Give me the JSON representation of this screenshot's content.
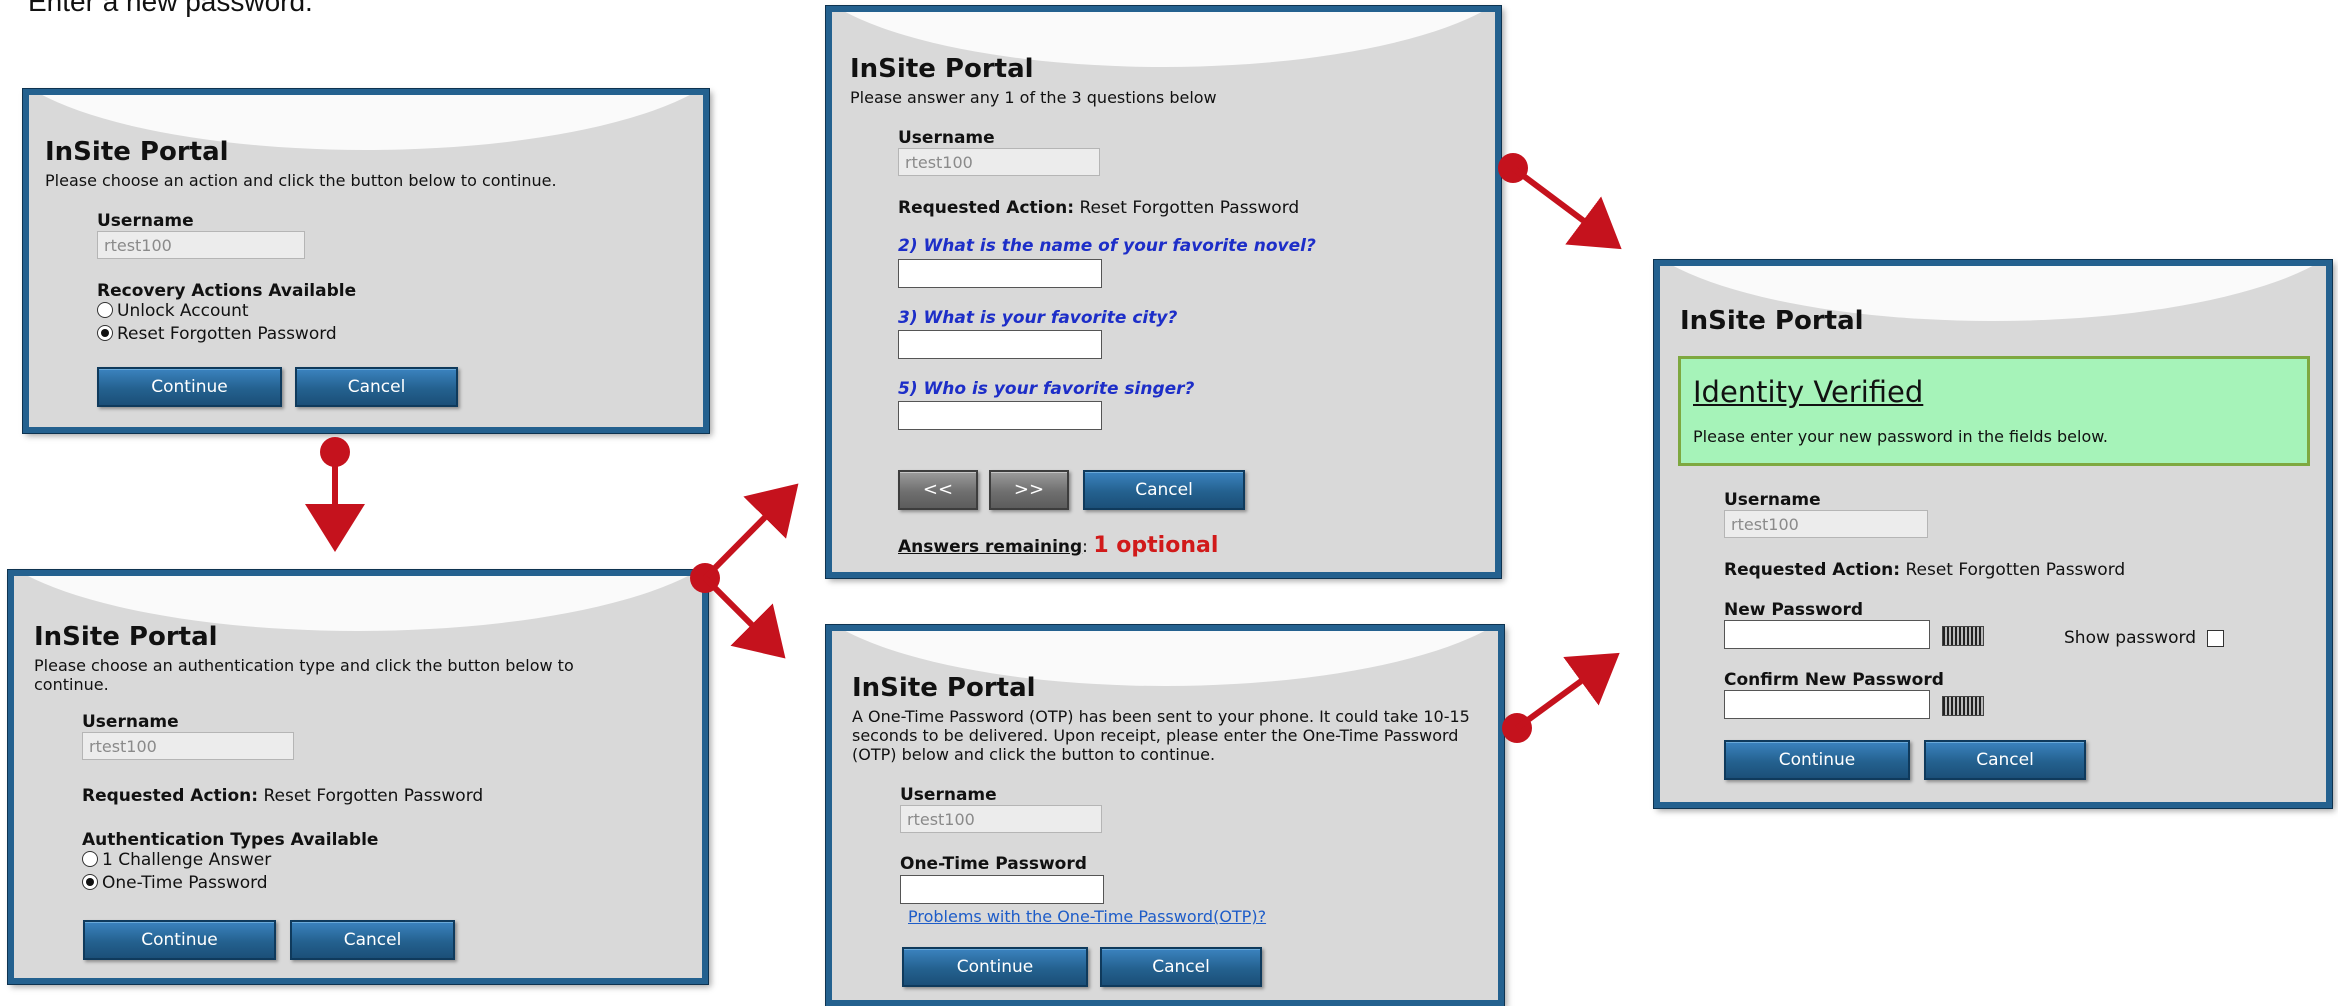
{
  "intro_text": "Enter a new password.",
  "portal_title": "InSite Portal",
  "panel1": {
    "description": "Please choose an action and click the button below to continue.",
    "username_label": "Username",
    "username_value": "rtest100",
    "options_heading": "Recovery Actions Available",
    "options": [
      "Unlock Account",
      "Reset Forgotten Password"
    ],
    "selected_option": "Reset Forgotten Password",
    "continue_label": "Continue",
    "cancel_label": "Cancel"
  },
  "panel2": {
    "description": "Please choose an authentication type and click the button below to continue.",
    "username_label": "Username",
    "username_value": "rtest100",
    "requested_action_label": "Requested Action:",
    "requested_action_value": "Reset Forgotten Password",
    "options_heading": "Authentication Types Available",
    "options": [
      "1 Challenge Answer",
      "One-Time Password"
    ],
    "selected_option": "One-Time Password",
    "continue_label": "Continue",
    "cancel_label": "Cancel"
  },
  "panel3": {
    "description": "Please answer any 1 of the 3 questions below",
    "username_label": "Username",
    "username_value": "rtest100",
    "requested_action_label": "Requested Action:",
    "requested_action_value": "Reset Forgotten Password",
    "questions": [
      "2) What is the name of your favorite novel?",
      "3) What is your favorite city?",
      "5) Who is your favorite singer?"
    ],
    "prev_label": "<<",
    "next_label": ">>",
    "cancel_label": "Cancel",
    "remaining_label": "Answers remaining",
    "remaining_value": "1 optional"
  },
  "panel4": {
    "description": "A One-Time Password (OTP) has been sent to your phone. It could take 10-15 seconds to be delivered. Upon receipt, please enter the One-Time Password (OTP) below and click the button to continue.",
    "username_label": "Username",
    "username_value": "rtest100",
    "otp_label": "One-Time Password",
    "otp_value": "",
    "otp_help_link": "Problems with the One-Time Password(OTP)?",
    "continue_label": "Continue",
    "cancel_label": "Cancel"
  },
  "panel5": {
    "verified_title": "Identity Verified",
    "verified_message": "Please enter your new password in the fields below.",
    "username_label": "Username",
    "username_value": "rtest100",
    "requested_action_label": "Requested Action:",
    "requested_action_value": "Reset Forgotten Password",
    "new_password_label": "New Password",
    "new_password_value": "",
    "show_password_label": "Show password",
    "show_password_checked": false,
    "confirm_password_label": "Confirm New Password",
    "confirm_password_value": "",
    "continue_label": "Continue",
    "cancel_label": "Cancel"
  },
  "colors": {
    "panel_border": "#24618f",
    "button_blue": "#24618f",
    "arrow_red": "#c5121d",
    "question_blue": "#1d2ec8",
    "remaining_red": "#d11a1a",
    "verified_green": "#a6f3b9"
  }
}
